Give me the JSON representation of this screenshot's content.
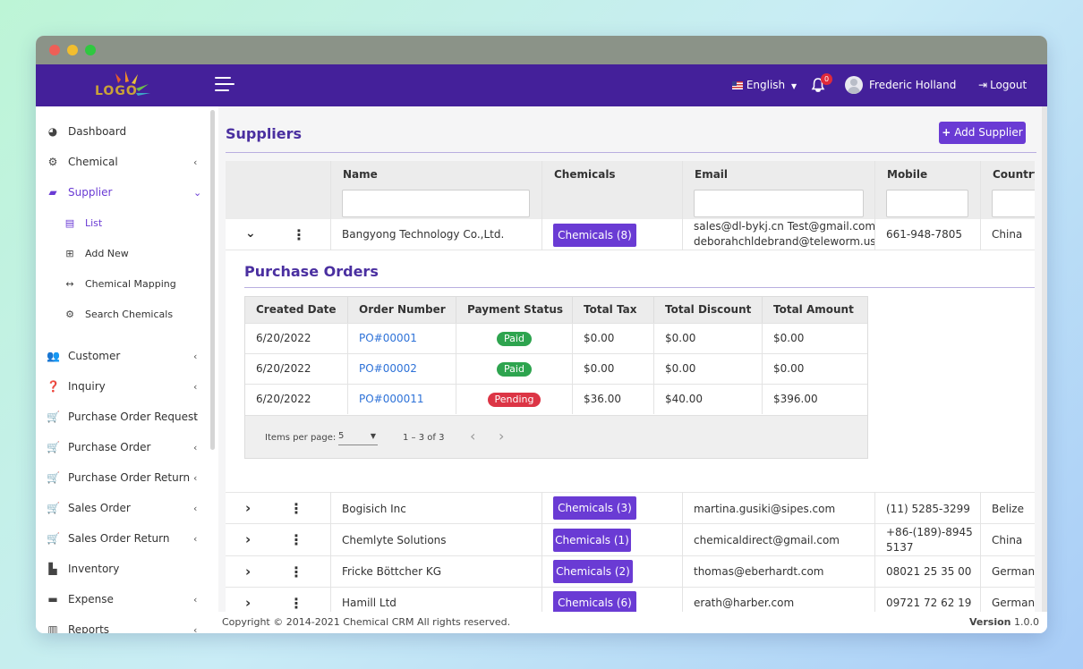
{
  "nav": {
    "logo_text": "LOGO",
    "language": "English",
    "notification_count": "0",
    "user_name": "Frederic Holland",
    "logout": "Logout"
  },
  "sidebar": {
    "items": [
      {
        "label": "Dashboard",
        "icon": "dashboard-icon"
      },
      {
        "label": "Chemical",
        "icon": "gear-icon"
      },
      {
        "label": "Supplier",
        "icon": "truck-icon"
      },
      {
        "label": "Customer",
        "icon": "users-icon"
      },
      {
        "label": "Inquiry",
        "icon": "question-icon"
      },
      {
        "label": "Purchase Order Request",
        "icon": "cart-icon"
      },
      {
        "label": "Purchase Order",
        "icon": "cart-icon"
      },
      {
        "label": "Purchase Order Return",
        "icon": "cart-icon"
      },
      {
        "label": "Sales Order",
        "icon": "cart-icon"
      },
      {
        "label": "Sales Order Return",
        "icon": "cart-icon"
      },
      {
        "label": "Inventory",
        "icon": "inventory-icon"
      },
      {
        "label": "Expense",
        "icon": "wallet-icon"
      },
      {
        "label": "Reports",
        "icon": "chart-icon"
      }
    ],
    "supplier_sub": [
      {
        "label": "List",
        "icon": "list-icon"
      },
      {
        "label": "Add New",
        "icon": "plus-square-icon"
      },
      {
        "label": "Chemical Mapping",
        "icon": "arrows-icon"
      },
      {
        "label": "Search Chemicals",
        "icon": "gear-icon"
      }
    ],
    "accent": "#6a3bd4"
  },
  "page": {
    "title": "Suppliers",
    "add_button": "Add Supplier"
  },
  "table": {
    "headers": [
      "Name",
      "Chemicals",
      "Email",
      "Mobile",
      "Country"
    ],
    "rows": [
      {
        "name": "Bangyong Technology Co.,Ltd.",
        "chemicals": "Chemicals (8)",
        "email1": "sales@dl-bykj.cn Test@gmail.com",
        "email2": "deborahchldebrand@teleworm.us",
        "mobile": "661-948-7805",
        "country": "China"
      },
      {
        "name": "Bogisich Inc",
        "chemicals": "Chemicals (3)",
        "email": "martina.gusiki@sipes.com",
        "mobile": "(11) 5285-3299",
        "country": "Belize"
      },
      {
        "name": "Chemlyte Solutions",
        "chemicals": "Chemicals (1)",
        "email": "chemicaldirect@gmail.com",
        "mobile1": "+86-(189)-8945",
        "mobile2": "5137",
        "country": "China"
      },
      {
        "name": "Fricke Böttcher KG",
        "chemicals": "Chemicals (2)",
        "email": "thomas@eberhardt.com",
        "mobile": "08021 25 35 00",
        "country": "German"
      },
      {
        "name": "Hamill Ltd",
        "chemicals": "Chemicals (6)",
        "email": "erath@harber.com",
        "mobile": "09721 72 62 19",
        "country": "German"
      }
    ]
  },
  "purchase_orders": {
    "title": "Purchase Orders",
    "headers": [
      "Created Date",
      "Order Number",
      "Payment Status",
      "Total Tax",
      "Total Discount",
      "Total Amount"
    ],
    "rows": [
      {
        "date": "6/20/2022",
        "order": "PO#00001",
        "status": "Paid",
        "status_color": "#2ea44f",
        "tax": "$0.00",
        "discount": "$0.00",
        "amount": "$0.00"
      },
      {
        "date": "6/20/2022",
        "order": "PO#00002",
        "status": "Paid",
        "status_color": "#2ea44f",
        "tax": "$0.00",
        "discount": "$0.00",
        "amount": "$0.00"
      },
      {
        "date": "6/20/2022",
        "order": "PO#000011",
        "status": "Pending",
        "status_color": "#dc3545",
        "tax": "$36.00",
        "discount": "$40.00",
        "amount": "$396.00"
      }
    ],
    "items_per_page_label": "Items per page:",
    "items_per_page": "5",
    "range": "1 – 3 of 3"
  },
  "footer": {
    "copyright": "Copyright © 2014-2021 Chemical CRM All rights reserved.",
    "version_label": "Version",
    "version": "1.0.0"
  }
}
